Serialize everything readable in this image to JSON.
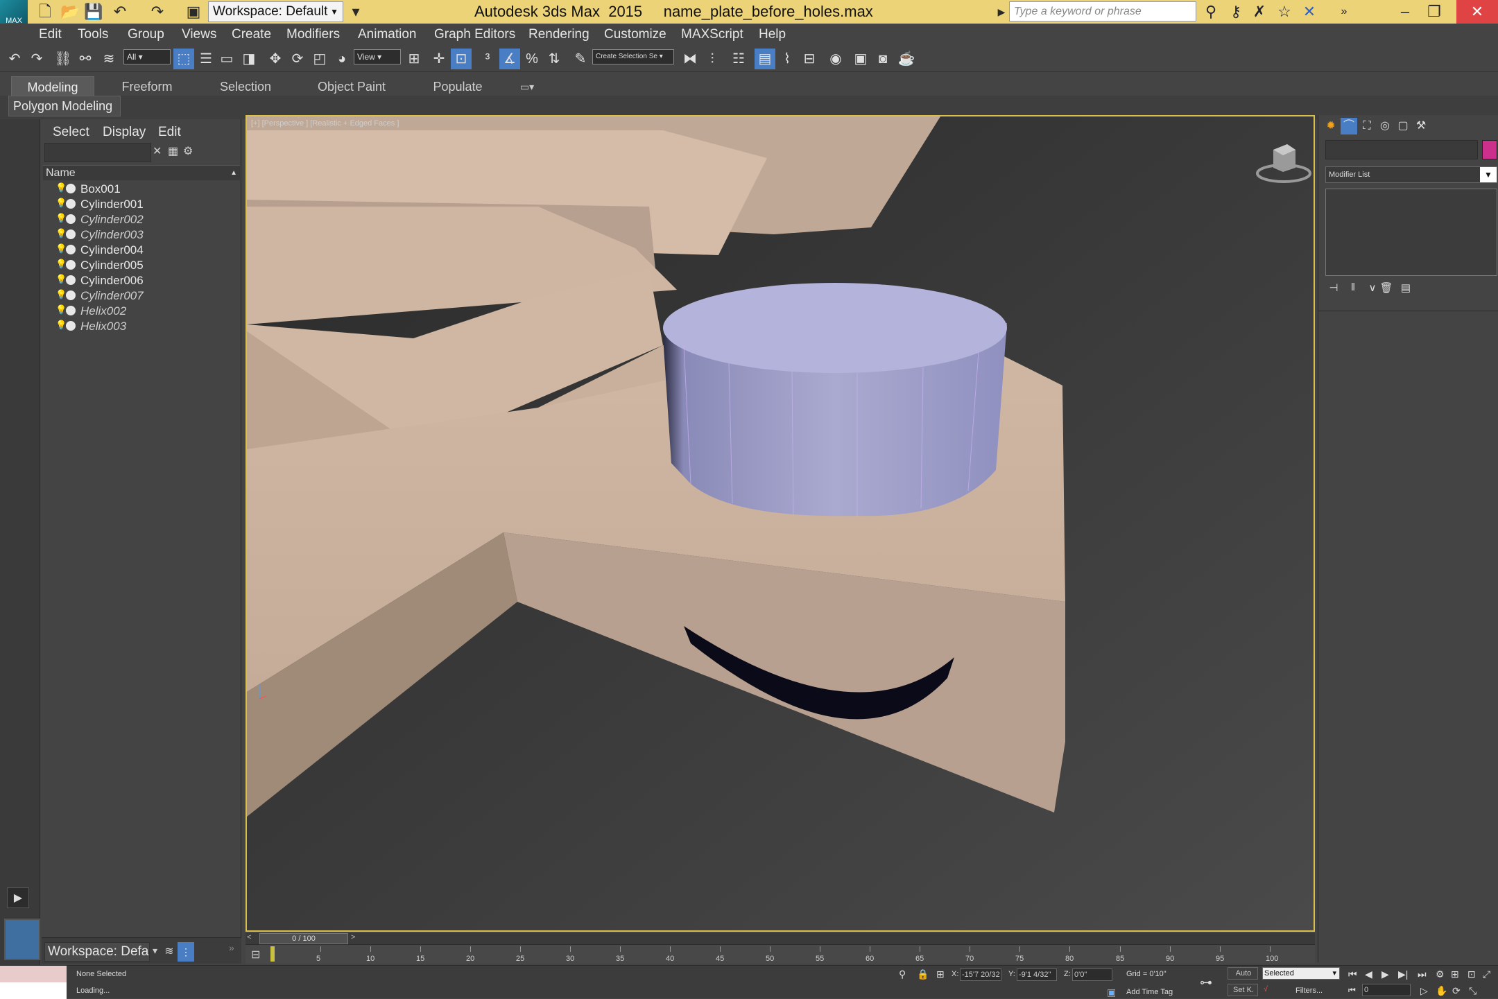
{
  "app": {
    "logo_text": "MAX",
    "title": "Autodesk 3ds Max  2015     name_plate_before_holes.max",
    "workspace": "Workspace: Default",
    "search_placeholder": "Type a keyword or phrase"
  },
  "menus": [
    "Edit",
    "Tools",
    "Group",
    "Views",
    "Create",
    "Modifiers",
    "Animation",
    "Graph Editors",
    "Rendering",
    "Customize",
    "MAXScript",
    "Help"
  ],
  "toolbar": {
    "selection_filter": "All",
    "ref_coord": "View",
    "named_selection": "Create Selection Se"
  },
  "ribbon": {
    "tabs": [
      "Modeling",
      "Freeform",
      "Selection",
      "Object Paint",
      "Populate"
    ],
    "panel": "Polygon Modeling"
  },
  "explorer": {
    "tabs": [
      "Select",
      "Display",
      "Edit"
    ],
    "column": "Name",
    "objects": [
      {
        "name": "Box001",
        "hidden": false
      },
      {
        "name": "Cylinder001",
        "hidden": false
      },
      {
        "name": "Cylinder002",
        "hidden": true
      },
      {
        "name": "Cylinder003",
        "hidden": true
      },
      {
        "name": "Cylinder004",
        "hidden": false
      },
      {
        "name": "Cylinder005",
        "hidden": false
      },
      {
        "name": "Cylinder006",
        "hidden": false
      },
      {
        "name": "Cylinder007",
        "hidden": true
      },
      {
        "name": "Helix002",
        "hidden": true
      },
      {
        "name": "Helix003",
        "hidden": true
      }
    ],
    "workspace_short": "Workspace: Defau"
  },
  "viewport": {
    "label": "[+] [Perspective ] [Realistic + Edged Faces ]"
  },
  "command_panel": {
    "modifier_list": "Modifier List",
    "object_color": "#cc2f8c"
  },
  "timeline": {
    "frame": "0 / 100",
    "ticks": [
      "5",
      "10",
      "15",
      "20",
      "25",
      "30",
      "35",
      "40",
      "45",
      "50",
      "55",
      "60",
      "65",
      "70",
      "75",
      "80",
      "85",
      "90",
      "95",
      "100"
    ]
  },
  "status": {
    "selection": "None Selected",
    "prompt": "Loading...",
    "x": "-15'7 20/32",
    "y": "-9'1 4/32\"",
    "z": "0'0\"",
    "grid": "Grid = 0'10\"",
    "auto": "Auto",
    "set_key": "Set K.",
    "key_mode": "Selected",
    "filters": "Filters...",
    "add_time_tag": "Add Time Tag",
    "frame": "0"
  },
  "colors": {
    "titlebar": "#ecd377",
    "viewport_border": "#d8c04a",
    "cylinder": "#a8a8d4",
    "plate": "#d8bca8"
  }
}
